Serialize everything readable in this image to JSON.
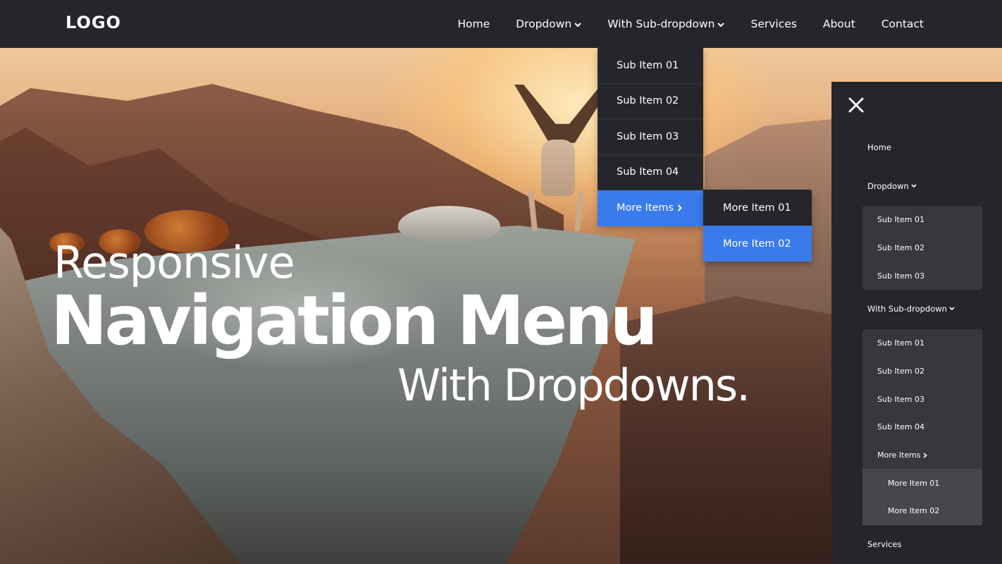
{
  "brand": {
    "logo": "LOGO"
  },
  "nav": {
    "items": [
      {
        "label": "Home",
        "has_chevron": false
      },
      {
        "label": "Dropdown",
        "has_chevron": true
      },
      {
        "label": "With Sub-dropdown",
        "has_chevron": true
      },
      {
        "label": "Services",
        "has_chevron": false
      },
      {
        "label": "About",
        "has_chevron": false
      },
      {
        "label": "Contact",
        "has_chevron": false
      }
    ]
  },
  "dropdown": {
    "items": [
      "Sub Item 01",
      "Sub Item 02",
      "Sub Item 03",
      "Sub Item 04",
      "More Items"
    ],
    "active_item": "More Items"
  },
  "subdropdown": {
    "items": [
      "More Item 01",
      "More Item 02"
    ],
    "active_item": "More Item 02"
  },
  "hero": {
    "line1": "Responsive",
    "line2": "Navigation Menu",
    "line3": "With Dropdowns."
  },
  "mobile_menu": {
    "home": "Home",
    "dropdown_label": "Dropdown",
    "dropdown_items": [
      "Sub Item 01",
      "Sub Item 02",
      "Sub Item 03"
    ],
    "subdropdown_label": "With Sub-dropdown",
    "subdropdown_items": [
      "Sub Item 01",
      "Sub Item 02",
      "Sub Item 03",
      "Sub Item 04"
    ],
    "more_items_label": "More Items",
    "more_items": [
      "More Item 01",
      "More Item 02"
    ],
    "services": "Services"
  },
  "colors": {
    "navbar_bg": "#24262b",
    "accent": "#3a7bec",
    "mobile_group_bg": "#36383d"
  },
  "icons": {
    "close": "close-icon",
    "chevron_down": "chevron-down-icon",
    "chevron_right": "chevron-right-icon"
  }
}
